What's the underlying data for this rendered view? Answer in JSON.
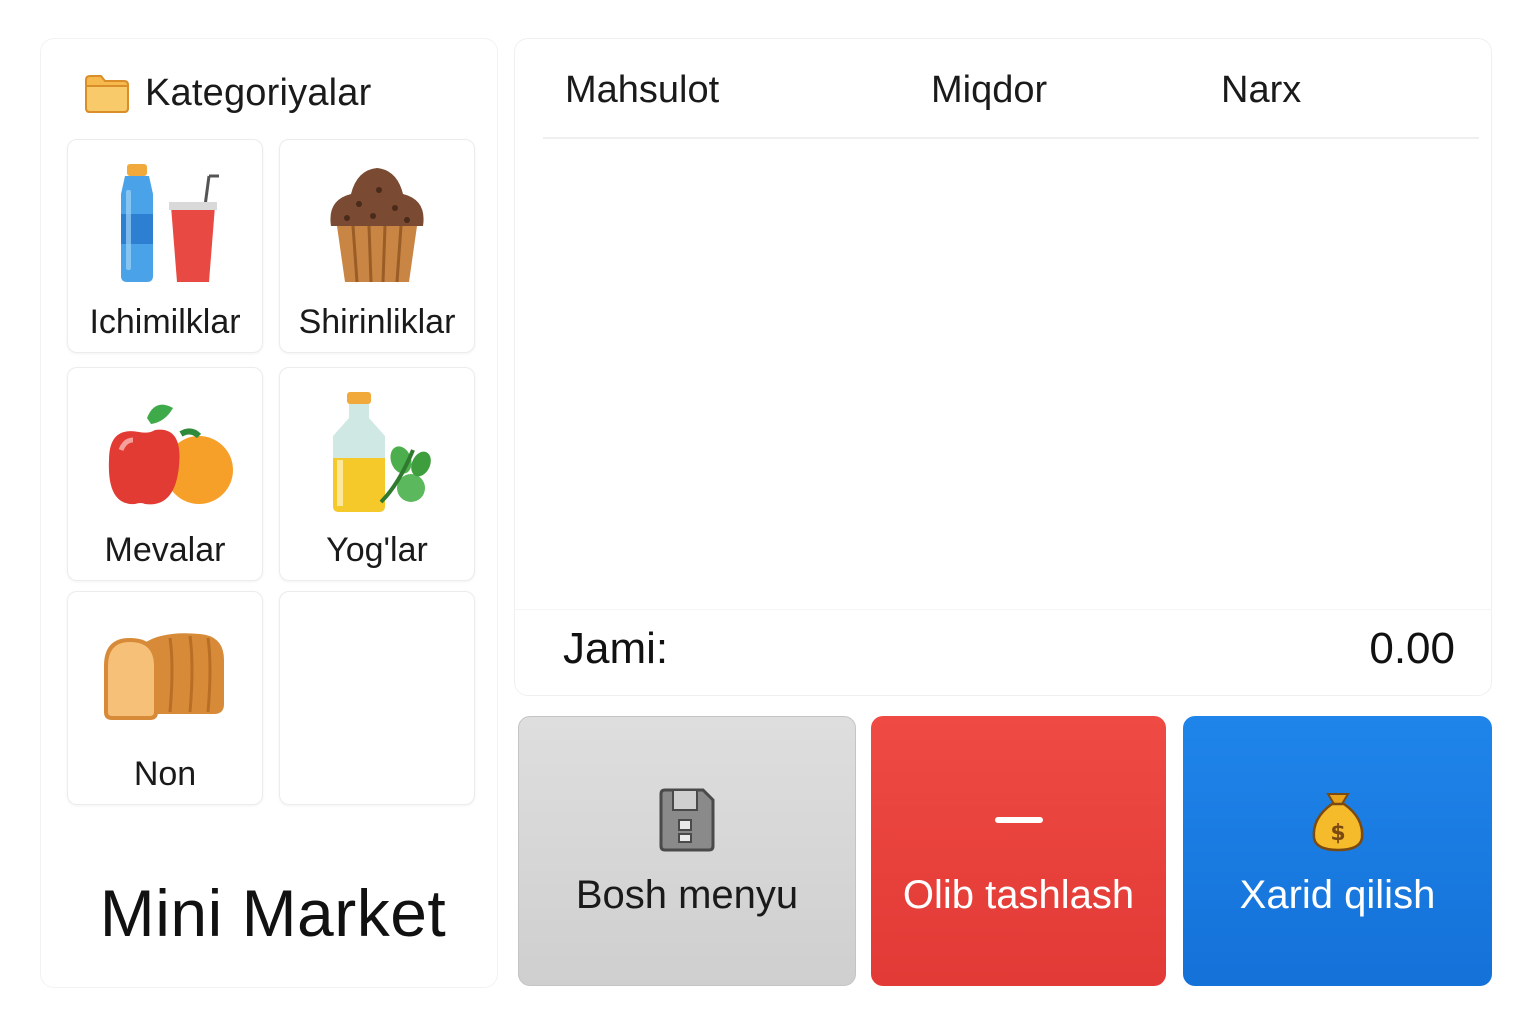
{
  "app": {
    "name": "Mini Market"
  },
  "categories": {
    "header": "Kategoriyalar",
    "header_icon": "folder-icon",
    "items": [
      {
        "label": "Ichimilklar",
        "icon": "drinks-icon"
      },
      {
        "label": "Shirinliklar",
        "icon": "muffin-icon"
      },
      {
        "label": "Mevalar",
        "icon": "fruits-icon"
      },
      {
        "label": "Yog'lar",
        "icon": "oil-bottle-icon"
      },
      {
        "label": "Non",
        "icon": "bread-icon"
      },
      {
        "label": "",
        "icon": ""
      }
    ]
  },
  "cart": {
    "columns": {
      "product": "Mahsulot",
      "quantity": "Miqdor",
      "price": "Narx"
    },
    "rows": [],
    "total_label": "Jami:",
    "total_value": "0.00"
  },
  "actions": {
    "home": {
      "label": "Bosh menyu",
      "icon": "save-floppy-icon"
    },
    "remove": {
      "label": "Olib tashlash",
      "icon": "minus-icon"
    },
    "buy": {
      "label": "Xarid qilish",
      "icon": "money-bag-icon"
    }
  },
  "colors": {
    "remove_button": "#e8403b",
    "buy_button": "#1a7be2",
    "home_button": "#d6d6d6"
  }
}
